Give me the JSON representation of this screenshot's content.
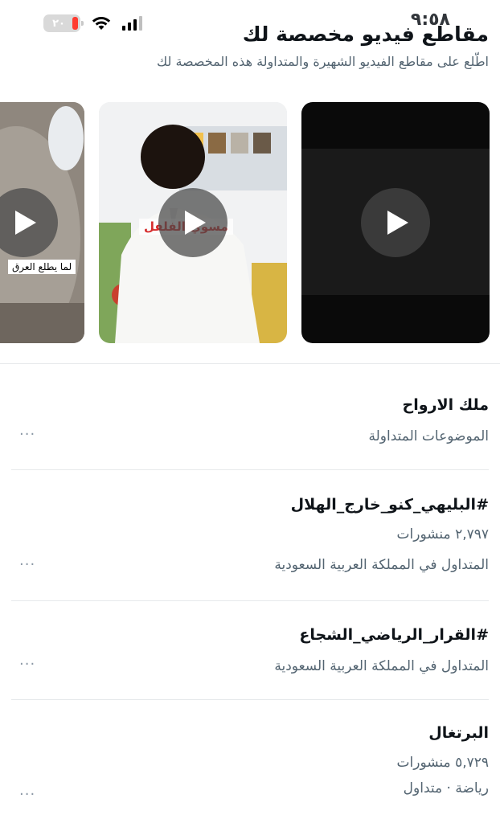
{
  "status_bar": {
    "time": "٩:٥٨",
    "battery": "٢٠"
  },
  "header": {
    "title": "مقاطع فيديو مخصصة لك",
    "subtitle": "اطّلع على مقاطع الفيديو الشهيرة والمتداولة هذه المخصصة لك"
  },
  "videos": [
    {
      "caption": ""
    },
    {
      "caption": "مسوي الفلفل"
    },
    {
      "caption": "لما يطلع العرق"
    }
  ],
  "trends": [
    {
      "title": "ملك الارواح",
      "lines": [
        "الموضوعات المتداولة"
      ],
      "more": "···"
    },
    {
      "title": "#البليهي_كنو_خارج_الهلال",
      "lines": [
        "٢,٧٩٧ منشورات",
        "المتداول في المملكة العربية السعودية"
      ],
      "more": "···"
    },
    {
      "title": "#القرار_الرياضي_الشجاع",
      "lines": [
        "المتداول في المملكة العربية السعودية"
      ],
      "more": "···"
    },
    {
      "title": "البرتغال",
      "lines": [
        "٥,٧٢٩ منشورات",
        "رياضة · متداول"
      ],
      "more": "···"
    }
  ]
}
